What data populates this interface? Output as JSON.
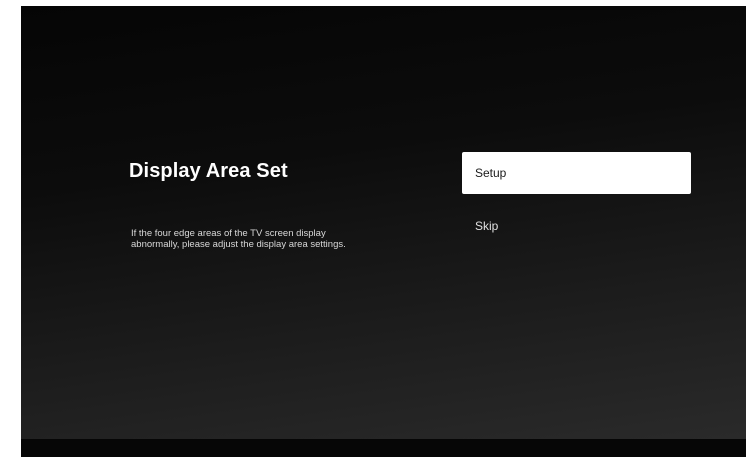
{
  "screen": {
    "title": "Display Area Set",
    "description_lines": [
      "If the four edge areas of the TV screen display",
      "abnormally, please adjust the display area settings."
    ]
  },
  "menu": {
    "items": [
      {
        "label": "Setup",
        "focused": true
      },
      {
        "label": "Skip",
        "focused": false
      }
    ]
  },
  "colors": {
    "background": "#0c0c0c",
    "focus_highlight": "#ffffff",
    "text_primary": "#ffffff"
  }
}
